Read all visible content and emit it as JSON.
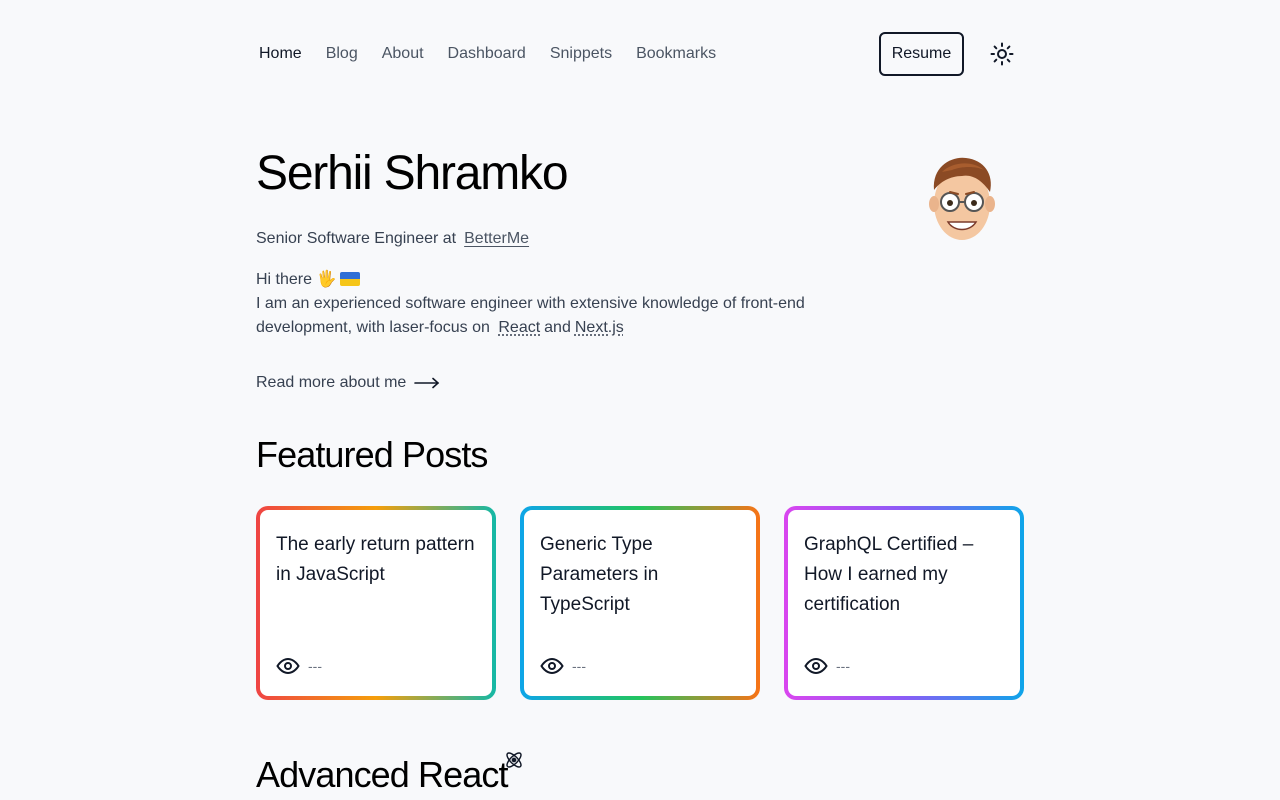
{
  "nav": {
    "links": [
      "Home",
      "Blog",
      "About",
      "Dashboard",
      "Snippets",
      "Bookmarks"
    ],
    "resume_label": "Resume",
    "theme_icon": "sun-icon"
  },
  "hero": {
    "name": "Serhii Shramko",
    "role_prefix": "Senior Software Engineer at",
    "company": "BetterMe",
    "greeting": "Hi there 🖐",
    "intro": "I am an experienced software engineer with extensive knowledge of front-end development, with laser-focus on",
    "tech1": "React",
    "and": "and",
    "tech2": "Next.js",
    "read_more": "Read more about me",
    "avatar_icon": "memoji-avatar"
  },
  "featured": {
    "title": "Featured Posts",
    "posts": [
      {
        "title": "The early return pattern in JavaScript",
        "views": "---"
      },
      {
        "title": "Generic Type Parameters in TypeScript",
        "views": "---"
      },
      {
        "title": "GraphQL Certified – How I earned my certification",
        "views": "---"
      }
    ]
  },
  "advanced": {
    "title": "Advanced React",
    "icon": "react-icon"
  }
}
